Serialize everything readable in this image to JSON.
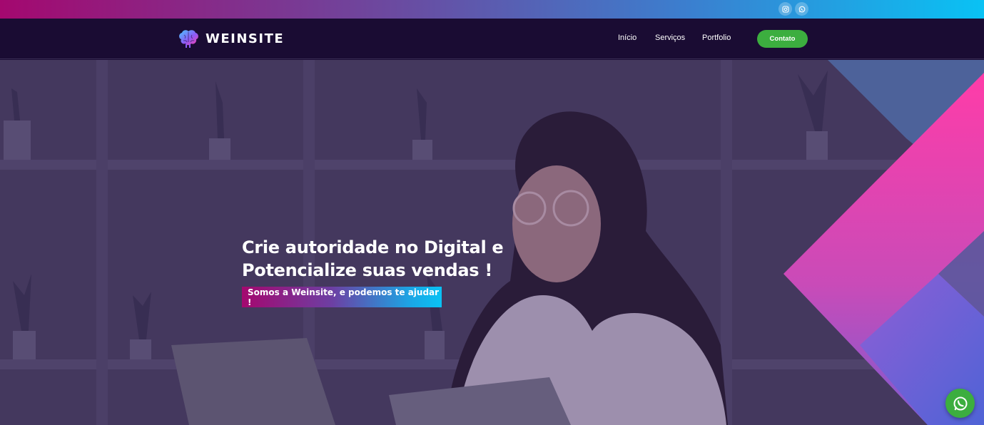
{
  "brand": {
    "name": "WEINSITE"
  },
  "topbar": {
    "icons": [
      "instagram-icon",
      "whatsapp-icon"
    ]
  },
  "nav": {
    "links": [
      "Início",
      "Serviços",
      "Portfolio"
    ],
    "cta": "Contato"
  },
  "hero": {
    "headline_line1": "Crie autoridade no Digital e",
    "headline_line2": "Potencialize suas vendas !",
    "subline": "Somos a Weinsite, e podemos te ajudar !"
  },
  "colors": {
    "nav_bg": "#1a0c33",
    "gradient_start": "#a4086f",
    "gradient_end": "#09c2f4",
    "cta_green": "#3cae3f",
    "accent_pink": "#ff3ca8"
  }
}
